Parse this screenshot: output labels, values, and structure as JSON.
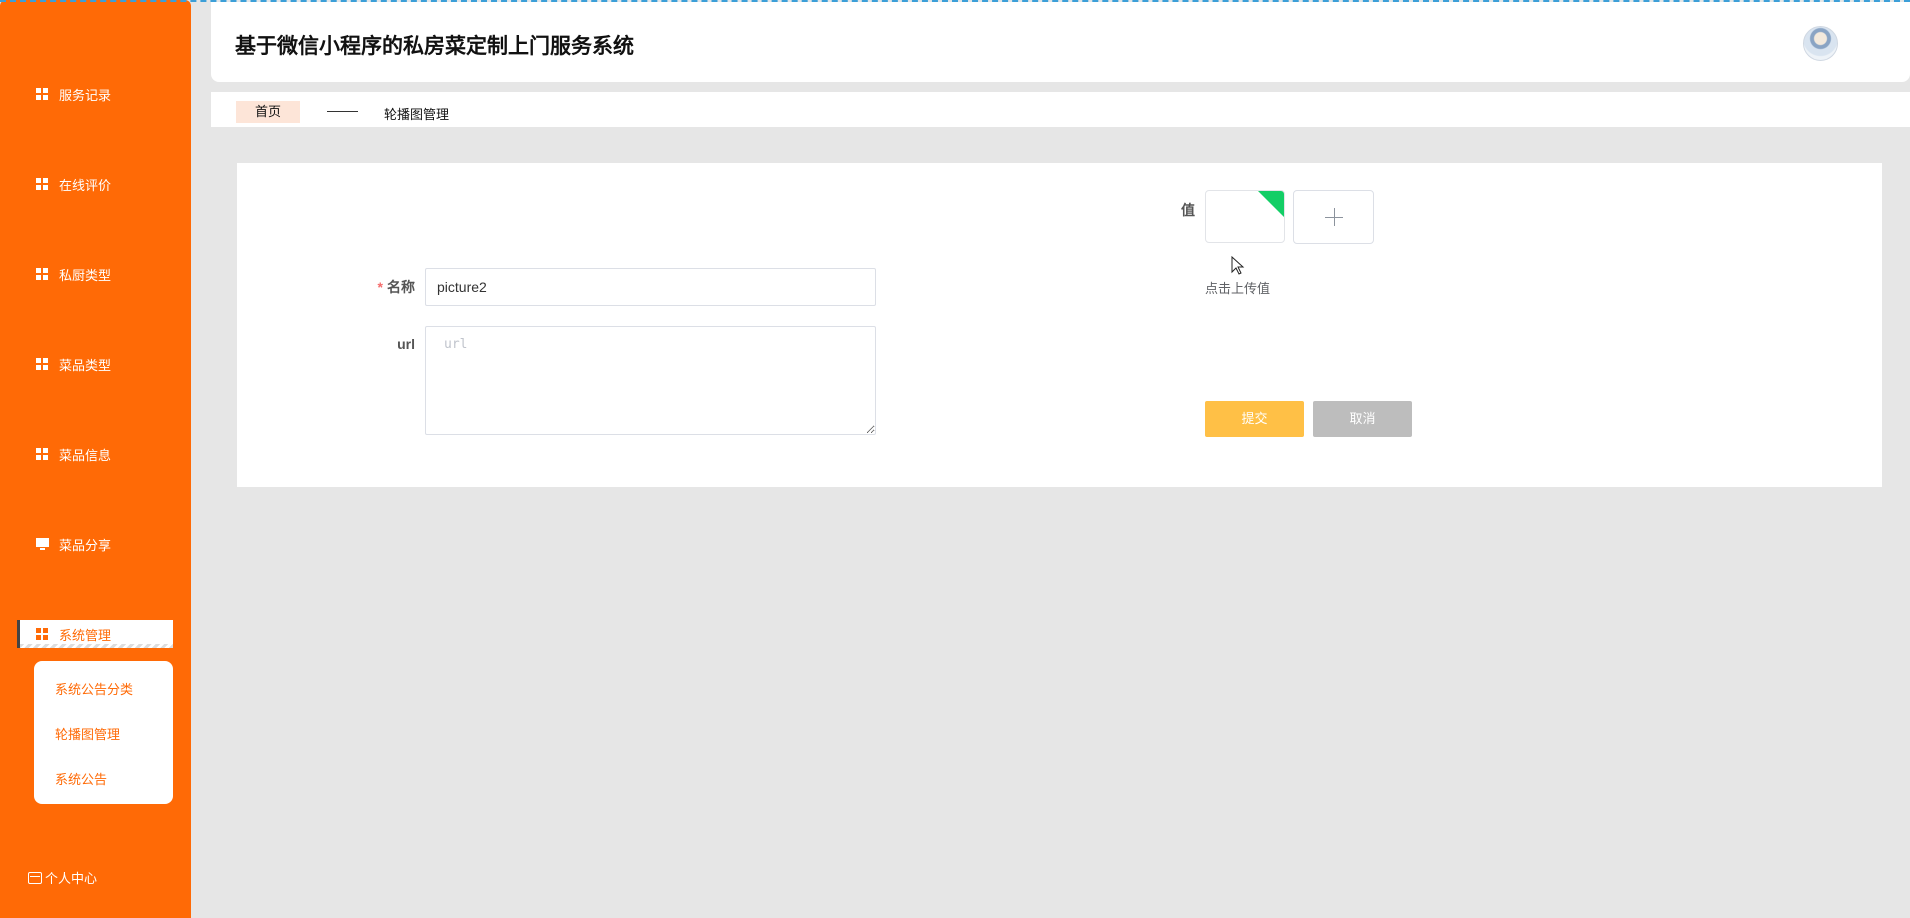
{
  "app": {
    "title": "基于微信小程序的私房菜定制上门服务系统"
  },
  "sidebar": {
    "items": [
      {
        "label": "服务记录",
        "icon": "grid-icon"
      },
      {
        "label": "在线评价",
        "icon": "grid-icon"
      },
      {
        "label": "私厨类型",
        "icon": "grid-icon"
      },
      {
        "label": "菜品类型",
        "icon": "grid-icon"
      },
      {
        "label": "菜品信息",
        "icon": "grid-icon"
      },
      {
        "label": "菜品分享",
        "icon": "monitor-icon"
      },
      {
        "label": "系统管理",
        "icon": "grid-icon",
        "active": true
      }
    ],
    "submenu": [
      {
        "label": "系统公告分类"
      },
      {
        "label": "轮播图管理"
      },
      {
        "label": "系统公告"
      }
    ],
    "profile_label": "个人中心"
  },
  "breadcrumb": {
    "home": "首页",
    "current": "轮播图管理"
  },
  "form": {
    "name_label": "名称",
    "name_required_mark": "*",
    "name_value": "picture2",
    "url_label": "url",
    "url_placeholder": "url",
    "value_label": "值",
    "upload_hint": "点击上传值",
    "submit_label": "提交",
    "cancel_label": "取消"
  },
  "colors": {
    "sidebar": "#ff6a06",
    "submit": "#ffc046",
    "cancel": "#bdbdbd",
    "upload_success": "#13ce66"
  }
}
